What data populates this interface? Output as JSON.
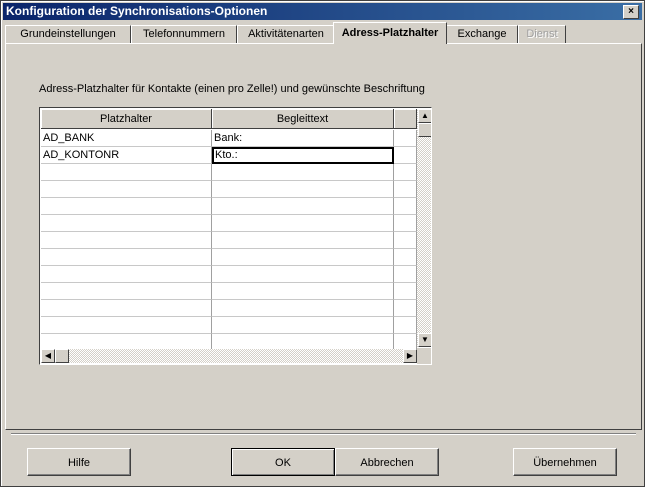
{
  "window": {
    "title": "Konfiguration der Synchronisations-Optionen",
    "close_label": "×"
  },
  "tabs": [
    {
      "label": "Grundeinstellungen",
      "active": false,
      "disabled": false
    },
    {
      "label": "Telefonnummern",
      "active": false,
      "disabled": false
    },
    {
      "label": "Aktivitätenarten",
      "active": false,
      "disabled": false
    },
    {
      "label": "Adress-Platzhalter",
      "active": true,
      "disabled": false
    },
    {
      "label": "Exchange",
      "active": false,
      "disabled": false
    },
    {
      "label": "Dienst",
      "active": false,
      "disabled": true
    }
  ],
  "panel": {
    "description": "Adress-Platzhalter für Kontakte (einen pro Zelle!) und gewünschte Beschriftung"
  },
  "grid": {
    "columns": [
      "Platzhalter",
      "Begleittext"
    ],
    "rows": [
      [
        "AD_BANK",
        "Bank:"
      ],
      [
        "AD_KONTONR",
        "Kto.:"
      ],
      [
        "",
        ""
      ],
      [
        "",
        ""
      ],
      [
        "",
        ""
      ],
      [
        "",
        ""
      ],
      [
        "",
        ""
      ],
      [
        "",
        ""
      ],
      [
        "",
        ""
      ],
      [
        "",
        ""
      ],
      [
        "",
        ""
      ],
      [
        "",
        ""
      ],
      [
        "",
        ""
      ]
    ]
  },
  "buttons": {
    "help": "Hilfe",
    "ok": "OK",
    "cancel": "Abbrechen",
    "apply": "Übernehmen"
  }
}
